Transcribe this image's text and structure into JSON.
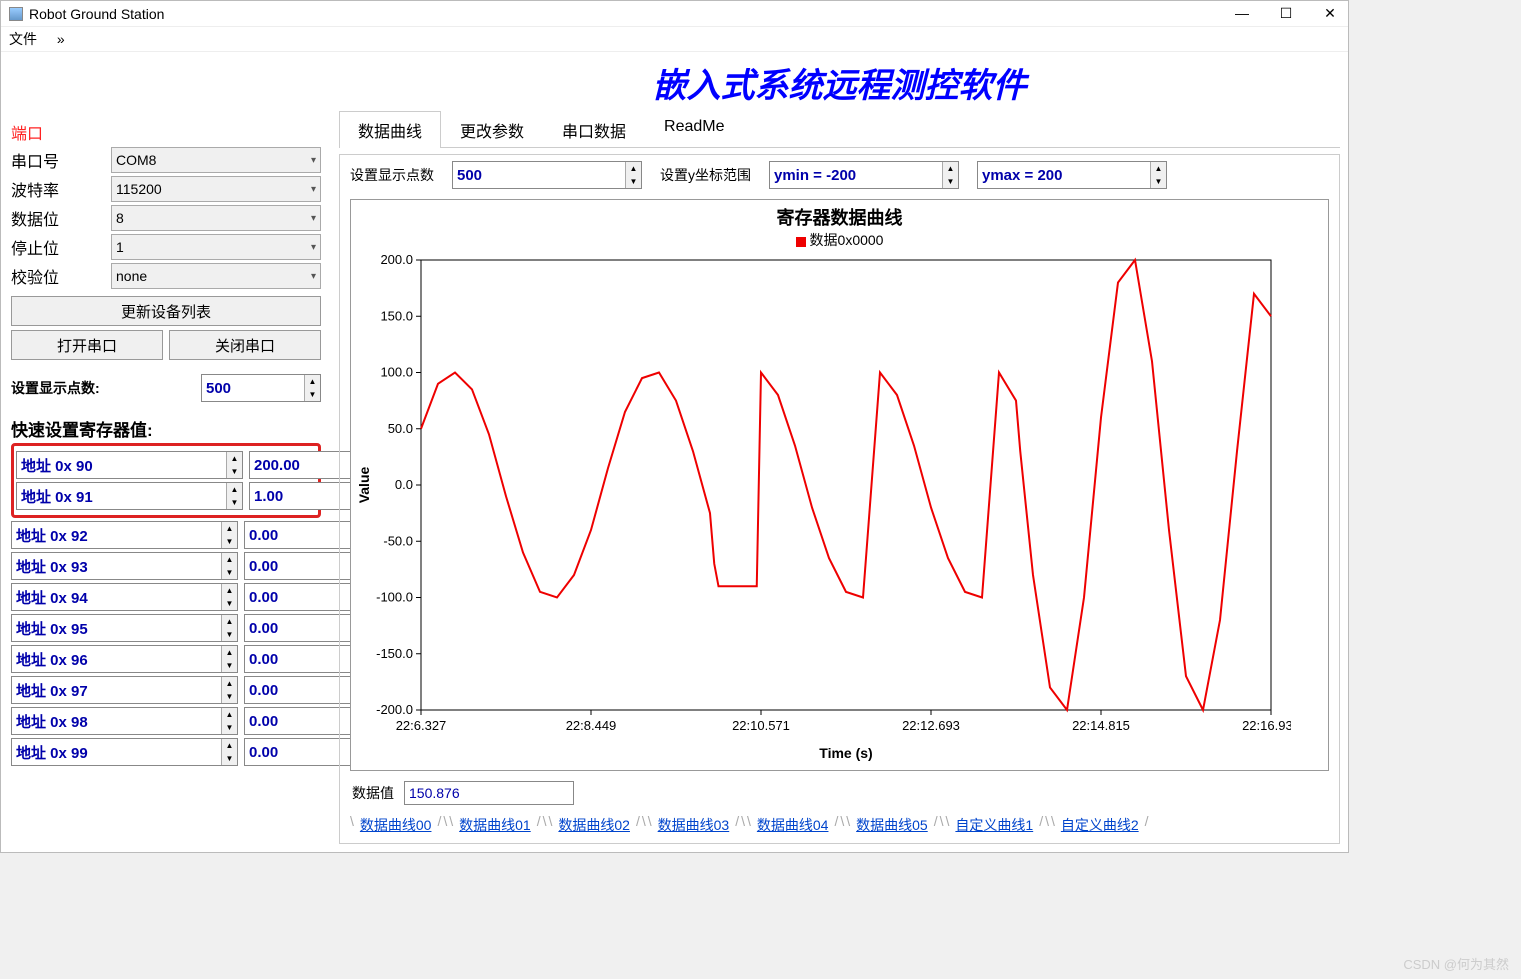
{
  "window": {
    "title": "Robot Ground Station"
  },
  "menubar": {
    "file": "文件",
    "more": "»"
  },
  "main_title": "嵌入式系统远程测控软件",
  "port_panel": {
    "label": "端口",
    "serial_label": "串口号",
    "serial_value": "COM8",
    "baud_label": "波特率",
    "baud_value": "115200",
    "data_label": "数据位",
    "data_value": "8",
    "stop_label": "停止位",
    "stop_value": "1",
    "parity_label": "校验位",
    "parity_value": "none",
    "refresh_btn": "更新设备列表",
    "open_btn": "打开串口",
    "close_btn": "关闭串口"
  },
  "display_points": {
    "label": "设置显示点数:",
    "value": "500"
  },
  "quick_set_label": "快速设置寄存器值:",
  "registers": [
    {
      "addr": "地址 0x 90",
      "val": "200.00",
      "hl": true
    },
    {
      "addr": "地址 0x 91",
      "val": "1.00",
      "hl": true
    },
    {
      "addr": "地址 0x 92",
      "val": "0.00"
    },
    {
      "addr": "地址 0x 93",
      "val": "0.00"
    },
    {
      "addr": "地址 0x 94",
      "val": "0.00"
    },
    {
      "addr": "地址 0x 95",
      "val": "0.00"
    },
    {
      "addr": "地址 0x 96",
      "val": "0.00"
    },
    {
      "addr": "地址 0x 97",
      "val": "0.00"
    },
    {
      "addr": "地址 0x 98",
      "val": "0.00"
    },
    {
      "addr": "地址 0x 99",
      "val": "0.00"
    }
  ],
  "tabs": {
    "items": [
      "数据曲线",
      "更改参数",
      "串口数据",
      "ReadMe"
    ],
    "active": 0
  },
  "chart_controls": {
    "points_label": "设置显示点数",
    "points_value": "500",
    "yrange_label": "设置y坐标范围",
    "ymin": "ymin = -200",
    "ymax": "ymax = 200"
  },
  "data_value": {
    "label": "数据值",
    "value": "150.876"
  },
  "bottom_tabs": [
    "数据曲线00",
    "数据曲线01",
    "数据曲线02",
    "数据曲线03",
    "数据曲线04",
    "数据曲线05",
    "自定义曲线1",
    "自定义曲线2"
  ],
  "watermark": "CSDN @何为其然",
  "chart_data": {
    "type": "line",
    "title": "寄存器数据曲线",
    "legend": "数据0x0000",
    "xlabel": "Time (s)",
    "ylabel": "Value",
    "ylim": [
      -200,
      200
    ],
    "xticks": [
      "22:6.327",
      "22:8.449",
      "22:10.571",
      "22:12.693",
      "22:14.815",
      "22:16.938"
    ],
    "yticks": [
      -200,
      -150,
      -100,
      -50,
      0,
      50,
      100,
      150,
      200
    ],
    "series": [
      {
        "name": "数据0x0000",
        "color": "#ee0000",
        "x": [
          0,
          0.02,
          0.04,
          0.06,
          0.08,
          0.1,
          0.12,
          0.14,
          0.16,
          0.18,
          0.2,
          0.22,
          0.24,
          0.26,
          0.28,
          0.3,
          0.32,
          0.34,
          0.345,
          0.35,
          0.37,
          0.39,
          0.395,
          0.4,
          0.42,
          0.44,
          0.46,
          0.48,
          0.5,
          0.52,
          0.54,
          0.56,
          0.58,
          0.6,
          0.62,
          0.64,
          0.66,
          0.68,
          0.7,
          0.705,
          0.72,
          0.74,
          0.76,
          0.78,
          0.8,
          0.82,
          0.84,
          0.86,
          0.88,
          0.9,
          0.92,
          0.94,
          0.96,
          0.98,
          1.0
        ],
        "y": [
          50,
          90,
          100,
          85,
          45,
          -10,
          -60,
          -95,
          -100,
          -80,
          -40,
          15,
          65,
          95,
          100,
          75,
          30,
          -25,
          -70,
          -90,
          -90,
          -90,
          -90,
          100,
          80,
          35,
          -20,
          -65,
          -95,
          -100,
          100,
          80,
          35,
          -20,
          -65,
          -95,
          -100,
          100,
          75,
          30,
          -80,
          -180,
          -200,
          -100,
          60,
          180,
          200,
          110,
          -40,
          -170,
          -200,
          -120,
          30,
          170,
          150
        ]
      }
    ]
  }
}
